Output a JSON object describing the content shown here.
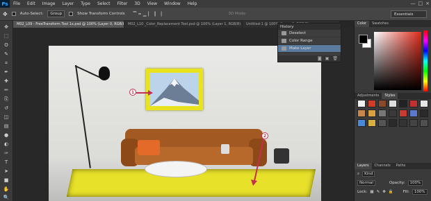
{
  "app": {
    "logo": "Ps"
  },
  "menu": [
    "File",
    "Edit",
    "Image",
    "Layer",
    "Type",
    "Select",
    "Filter",
    "3D",
    "View",
    "Window",
    "Help"
  ],
  "window_controls": {
    "minimize": "—",
    "maximize": "□",
    "close": "×"
  },
  "options_bar": {
    "auto_select_label": "Auto-Select:",
    "auto_select_value": "Group",
    "show_transform_label": "Show Transform Controls",
    "mode_label": "3D Mode:",
    "workspace": "Essentials"
  },
  "tabs": [
    "M02_L09 - FreeTransform Tool 1x.psd @ 100% (Layer 0, RGB/8) *",
    "M02_L10 _Color_Replacement Tool.psd @ 100% (Layer 1, RGB/8)",
    "Untitled-1 @ 100% (Layer 1, RGB/8)"
  ],
  "tools": [
    "move-tool",
    "marquee-tool",
    "lasso-tool",
    "quick-select-tool",
    "crop-tool",
    "eyedropper-tool",
    "healing-tool",
    "brush-tool",
    "clone-tool",
    "history-brush-tool",
    "eraser-tool",
    "gradient-tool",
    "blur-tool",
    "dodge-tool",
    "pen-tool",
    "type-tool",
    "path-select-tool",
    "shape-tool",
    "hand-tool",
    "zoom-tool"
  ],
  "tool_glyphs": [
    "✥",
    "⬚",
    "ʘ",
    "✎",
    "⌗",
    "✒",
    "✚",
    "✏",
    "⎘",
    "↺",
    "◫",
    "▤",
    "●",
    "◐",
    "✑",
    "T",
    "➤",
    "■",
    "✋",
    "🔍"
  ],
  "history": {
    "title": "History",
    "items": [
      {
        "label": "Deselect",
        "selected": false
      },
      {
        "label": "Color Range",
        "selected": false
      },
      {
        "label": "Make Layer",
        "selected": true
      }
    ],
    "footer_icons": [
      "snapshot-icon",
      "new-document-icon",
      "trash-icon"
    ]
  },
  "color_panel": {
    "tabs": [
      "Color",
      "Swatches"
    ],
    "fg": "#000000",
    "bg": "#ffffff",
    "hue": "#e02a1a"
  },
  "adjustments_panel": {
    "tabs": [
      "Adjustments",
      "Styles"
    ]
  },
  "styles_colors": [
    "#f0f0f0",
    "#d23a2a",
    "#8a4a2a",
    "#ddd",
    "#222",
    "#c43030",
    "#e6e6e6",
    "#c9884a",
    "#d8a040",
    "#777",
    "#3a3a3a",
    "#c93a30",
    "#5a7ad0",
    "#2a2a2a",
    "#4a8ad8",
    "#d9b040",
    "#555",
    "#2a2a2a",
    "#333",
    "#444",
    "#505050"
  ],
  "layers_panel": {
    "tabs": [
      "Layers",
      "Channels",
      "Paths"
    ],
    "kind_label": "Kind",
    "blend_mode": "Normal",
    "opacity_label": "Opacity:",
    "opacity_value": "100%",
    "lock_label": "Lock:",
    "fill_label": "Fill:",
    "fill_value": "100%"
  },
  "callouts": [
    "1",
    "2"
  ]
}
